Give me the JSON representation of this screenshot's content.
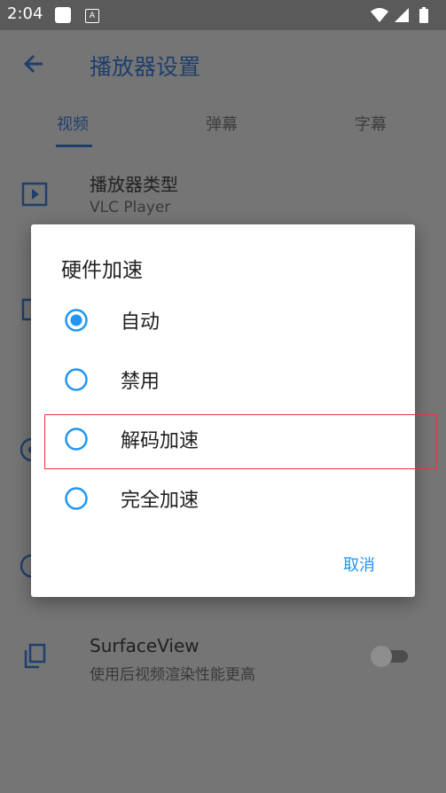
{
  "status_bar": {
    "time": "2:04",
    "badge": "A"
  },
  "app_bar": {
    "title": "播放器设置"
  },
  "tabs": [
    {
      "label": "视频",
      "active": true
    },
    {
      "label": "弹幕",
      "active": false
    },
    {
      "label": "字幕",
      "active": false
    }
  ],
  "settings": {
    "player_type": {
      "title": "播放器类型",
      "subtitle": "VLC Player"
    },
    "surface_view": {
      "title": "SurfaceView",
      "subtitle": "使用后视频渲染性能更高",
      "enabled": false
    }
  },
  "dialog": {
    "title": "硬件加速",
    "options": [
      {
        "label": "自动",
        "selected": true
      },
      {
        "label": "禁用",
        "selected": false
      },
      {
        "label": "解码加速",
        "selected": false
      },
      {
        "label": "完全加速",
        "selected": false
      }
    ],
    "cancel_label": "取消"
  },
  "colors": {
    "accent": "#2196f3",
    "scrim": "#757575",
    "highlight": "#e53935"
  }
}
